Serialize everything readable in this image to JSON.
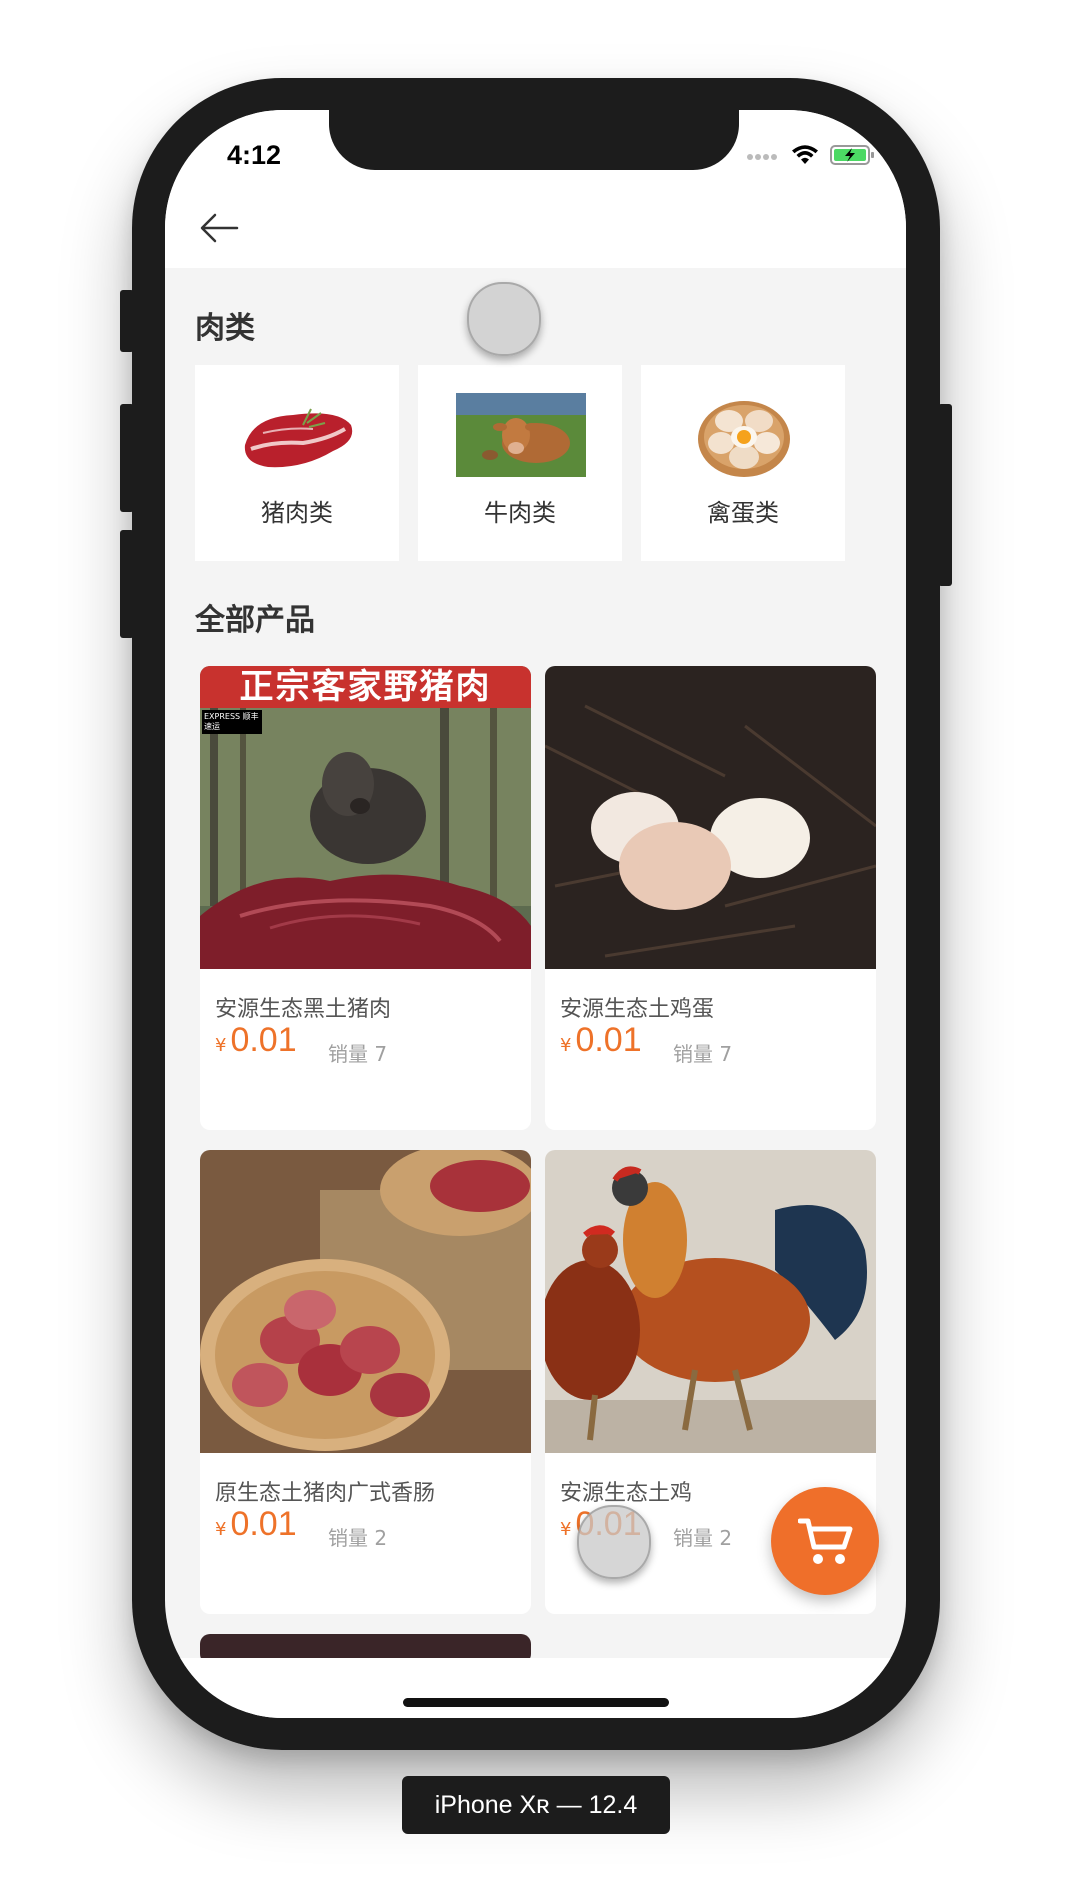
{
  "status_bar": {
    "time": "4:12"
  },
  "categories_section": {
    "title": "肉类",
    "items": [
      {
        "label": "猪肉类",
        "icon": "meat-steak-image"
      },
      {
        "label": "牛肉类",
        "icon": "cow-image"
      },
      {
        "label": "禽蛋类",
        "icon": "eggs-image"
      }
    ]
  },
  "products_section": {
    "title": "全部产品",
    "currency_symbol": "¥",
    "sales_prefix": "销量",
    "items": [
      {
        "name": "安源生态黑土猪肉",
        "price": "0.01",
        "sales": "销量 7",
        "banner": "正宗客家野猪肉",
        "badge": "EXPRESS 顺丰速运"
      },
      {
        "name": "安源生态土鸡蛋",
        "price": "0.01",
        "sales": "销量 7"
      },
      {
        "name": "原生态土猪肉广式香肠",
        "price": "0.01",
        "sales": "销量 2"
      },
      {
        "name": "安源生态土鸡",
        "price": "0.01",
        "sales": "销量 2"
      }
    ]
  },
  "device_label": "iPhone Xʀ — 12.4",
  "colors": {
    "accent": "#ee7229",
    "cart_button": "#ef6f2a",
    "background": "#f4f4f4"
  }
}
